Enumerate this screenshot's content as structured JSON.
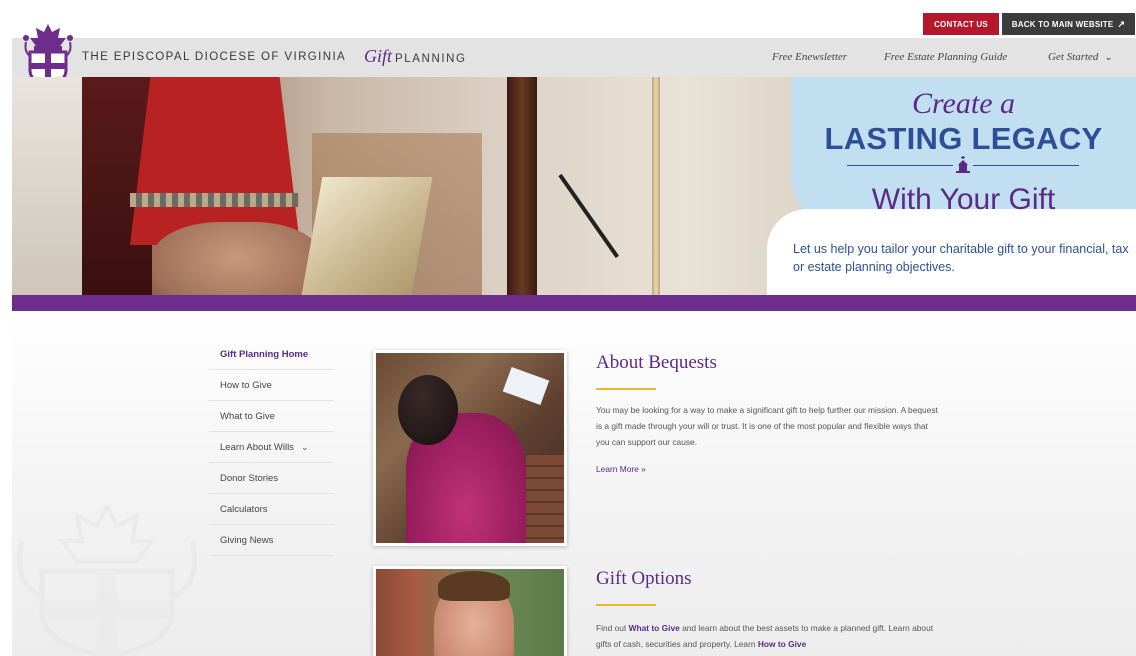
{
  "utility": {
    "contact_label": "CONTACT US",
    "back_label": "BACK TO MAIN WEBSITE",
    "back_icon": "external-arrow-icon"
  },
  "header": {
    "org_name": "THE EPISCOPAL DIOCESE OF VIRGINIA",
    "brand_gift": "Gift",
    "brand_planning": "PLANNING",
    "nav": [
      {
        "label": "Free Enewsletter"
      },
      {
        "label": "Free Estate Planning Guide"
      },
      {
        "label": "Get Started"
      }
    ]
  },
  "hero": {
    "line1": "Create a",
    "line2": "LASTING LEGACY",
    "line3": "With Your Gift",
    "description": "Let us help you tailor your charitable gift to your financial, tax or estate planning objectives."
  },
  "sidebar": {
    "items": [
      {
        "label": "Gift Planning Home",
        "active": true
      },
      {
        "label": "How to Give"
      },
      {
        "label": "What to Give"
      },
      {
        "label": "Learn About Wills"
      },
      {
        "label": "Donor Stories"
      },
      {
        "label": "Calculators"
      },
      {
        "label": "Giving News"
      }
    ]
  },
  "cards": [
    {
      "title": "About Bequests",
      "text": "You may be looking for a way to make a significant gift to help further our mission. A bequest is a gift made through your will or trust. It is one of the most popular and flexible ways that you can support our cause.",
      "link": "Learn More »"
    },
    {
      "title": "Gift Options",
      "text_1": "Find out ",
      "link_what": "What to Give",
      "text_2": " and learn about the best assets to make a planned gift. Learn about gifts of cash, securities and property. Learn ",
      "link_how": "How to Give"
    }
  ],
  "colors": {
    "purple": "#6e2d8c",
    "brand_purple": "#5b2a86",
    "blue": "#2e4f95",
    "light_blue": "#c2dff1",
    "red": "#b5182d",
    "gold": "#e8b830"
  }
}
